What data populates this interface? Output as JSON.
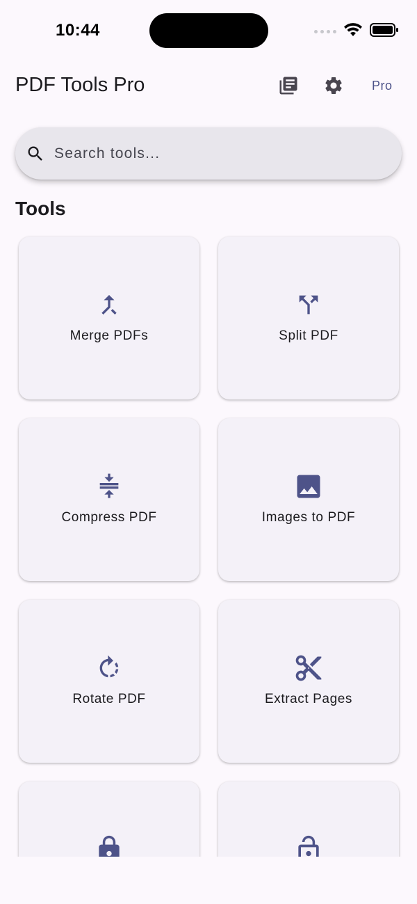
{
  "status_bar": {
    "time": "10:44"
  },
  "app_bar": {
    "title": "PDF Tools Pro",
    "library_icon": "library-books-icon",
    "settings_icon": "gear-icon",
    "pro_label": "Pro"
  },
  "search": {
    "placeholder": "Search tools...",
    "value": "",
    "icon": "search-icon"
  },
  "section": {
    "title": "Tools"
  },
  "tools": [
    {
      "label": "Merge PDFs",
      "icon": "merge-icon"
    },
    {
      "label": "Split PDF",
      "icon": "split-icon"
    },
    {
      "label": "Compress PDF",
      "icon": "compress-icon"
    },
    {
      "label": "Images to PDF",
      "icon": "image-icon"
    },
    {
      "label": "Rotate PDF",
      "icon": "rotate-icon"
    },
    {
      "label": "Extract Pages",
      "icon": "scissors-icon"
    },
    {
      "label": "",
      "icon": "lock-icon"
    },
    {
      "label": "",
      "icon": "lock-open-icon"
    }
  ],
  "colors": {
    "background": "#fcf8fd",
    "accent": "#4c5289",
    "icon": "#4e5389",
    "card": "#f4f1f8",
    "search_bg": "#e8e6ec"
  }
}
